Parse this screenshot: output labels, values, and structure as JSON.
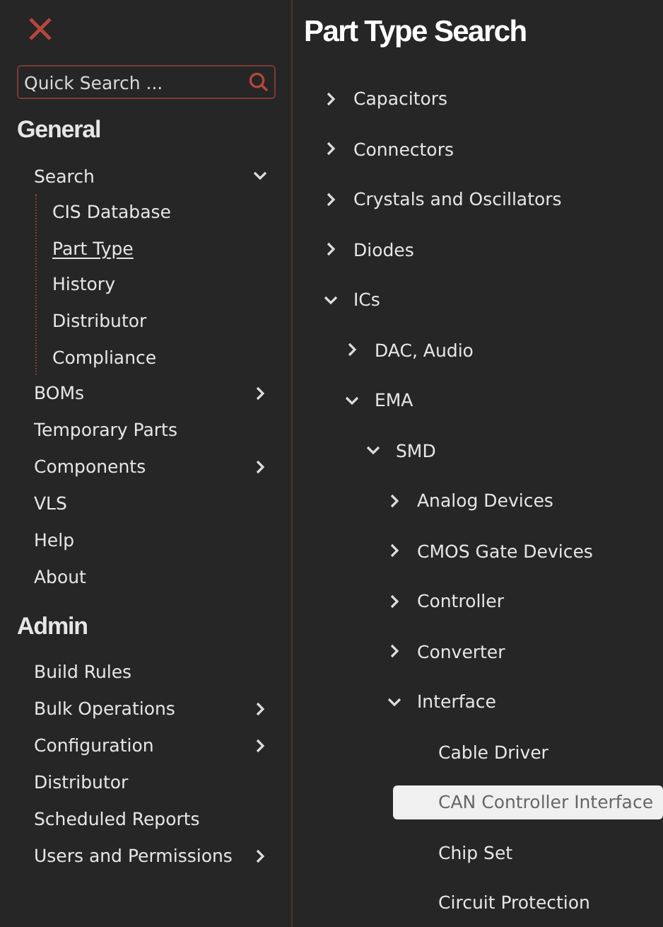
{
  "search": {
    "placeholder": "Quick Search ..."
  },
  "sidebar": {
    "sections": [
      {
        "title": "General",
        "items": [
          {
            "label": "Search",
            "kind": "group",
            "expanded": true,
            "selected": false,
            "children": [
              {
                "label": "CIS Database",
                "selected": false
              },
              {
                "label": "Part Type",
                "selected": true
              },
              {
                "label": "History",
                "selected": false
              },
              {
                "label": "Distributor",
                "selected": false
              },
              {
                "label": "Compliance",
                "selected": false
              }
            ]
          },
          {
            "label": "BOMs",
            "kind": "group",
            "expanded": false,
            "selected": false
          },
          {
            "label": "Temporary Parts",
            "kind": "link",
            "selected": false
          },
          {
            "label": "Components",
            "kind": "group",
            "expanded": false,
            "selected": false
          },
          {
            "label": "VLS",
            "kind": "link",
            "selected": false
          },
          {
            "label": "Help",
            "kind": "link",
            "selected": false
          },
          {
            "label": "About",
            "kind": "link",
            "selected": false
          }
        ]
      },
      {
        "title": "Admin",
        "items": [
          {
            "label": "Build Rules",
            "kind": "link",
            "selected": false
          },
          {
            "label": "Bulk Operations",
            "kind": "group",
            "expanded": false,
            "selected": false
          },
          {
            "label": "Configuration",
            "kind": "group",
            "expanded": false,
            "selected": false
          },
          {
            "label": "Distributor",
            "kind": "link",
            "selected": false
          },
          {
            "label": "Scheduled Reports",
            "kind": "link",
            "selected": false
          },
          {
            "label": "Users and Permissions",
            "kind": "group",
            "expanded": false,
            "selected": false
          }
        ]
      }
    ]
  },
  "page": {
    "title": "Part Type Search"
  },
  "tree": [
    {
      "label": "Capacitors",
      "kind": "folder",
      "expanded": false,
      "selected": false
    },
    {
      "label": "Connectors",
      "kind": "folder",
      "expanded": false,
      "selected": false
    },
    {
      "label": "Crystals and Oscillators",
      "kind": "folder",
      "expanded": false,
      "selected": false
    },
    {
      "label": "Diodes",
      "kind": "folder",
      "expanded": false,
      "selected": false
    },
    {
      "label": "ICs",
      "kind": "folder",
      "expanded": true,
      "selected": false,
      "children": [
        {
          "label": "DAC, Audio",
          "kind": "folder",
          "expanded": false,
          "selected": false
        },
        {
          "label": "EMA",
          "kind": "folder",
          "expanded": true,
          "selected": false,
          "children": [
            {
              "label": "SMD",
              "kind": "folder",
              "expanded": true,
              "selected": false,
              "children": [
                {
                  "label": "Analog Devices",
                  "kind": "folder",
                  "expanded": false,
                  "selected": false
                },
                {
                  "label": "CMOS Gate Devices",
                  "kind": "folder",
                  "expanded": false,
                  "selected": false
                },
                {
                  "label": "Controller",
                  "kind": "folder",
                  "expanded": false,
                  "selected": false
                },
                {
                  "label": "Converter",
                  "kind": "folder",
                  "expanded": false,
                  "selected": false
                },
                {
                  "label": "Interface",
                  "kind": "folder",
                  "expanded": true,
                  "selected": false,
                  "children": [
                    {
                      "label": "Cable Driver",
                      "kind": "leaf",
                      "selected": false
                    },
                    {
                      "label": "CAN Controller Interface",
                      "kind": "leaf",
                      "selected": true
                    },
                    {
                      "label": "Chip Set",
                      "kind": "leaf",
                      "selected": false
                    },
                    {
                      "label": "Circuit Protection",
                      "kind": "leaf",
                      "selected": false
                    }
                  ]
                }
              ]
            }
          ]
        }
      ]
    }
  ]
}
